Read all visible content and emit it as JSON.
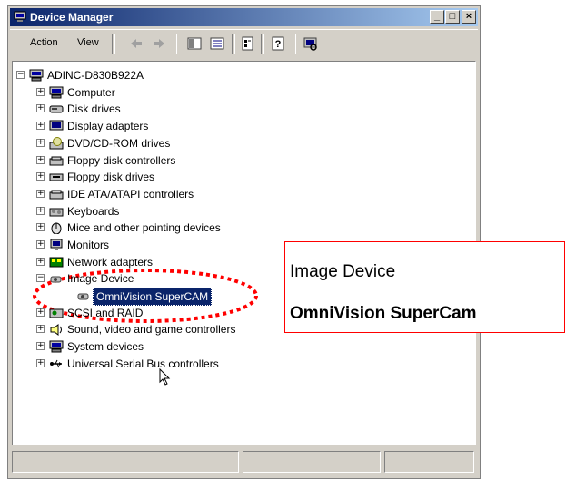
{
  "window": {
    "title": "Device Manager",
    "controls": [
      "minimize",
      "maximize",
      "close"
    ]
  },
  "menu": {
    "items": [
      "Action",
      "View"
    ]
  },
  "toolbar": {
    "icons": [
      "back-arrow-icon",
      "forward-arrow-icon",
      "show-hide-tree-icon",
      "properties-icon",
      "export-list-icon",
      "help-icon",
      "scan-hardware-icon"
    ]
  },
  "tree": {
    "root": "ADINC-D830B922A",
    "items": [
      {
        "label": "Computer",
        "icon": "computer-icon",
        "expanded": false
      },
      {
        "label": "Disk drives",
        "icon": "disk-drive-icon",
        "expanded": false
      },
      {
        "label": "Display adapters",
        "icon": "display-icon",
        "expanded": false
      },
      {
        "label": "DVD/CD-ROM drives",
        "icon": "cdrom-icon",
        "expanded": false
      },
      {
        "label": "Floppy disk controllers",
        "icon": "controller-icon",
        "expanded": false
      },
      {
        "label": "Floppy disk drives",
        "icon": "floppy-drive-icon",
        "expanded": false
      },
      {
        "label": "IDE ATA/ATAPI controllers",
        "icon": "controller-icon",
        "expanded": false
      },
      {
        "label": "Keyboards",
        "icon": "keyboard-icon",
        "expanded": false
      },
      {
        "label": "Mice and other pointing devices",
        "icon": "mouse-icon",
        "expanded": false
      },
      {
        "label": "Monitors",
        "icon": "monitor-icon",
        "expanded": false
      },
      {
        "label": "Network adapters",
        "icon": "network-icon",
        "expanded": false
      },
      {
        "label": "Image Device",
        "icon": "camera-icon",
        "expanded": true
      },
      {
        "label": "SCSI and RAID",
        "icon": "scsi-icon",
        "expanded": false
      },
      {
        "label": "Sound, video and game controllers",
        "icon": "sound-icon",
        "expanded": false
      },
      {
        "label": "System devices",
        "icon": "computer-icon",
        "expanded": false
      },
      {
        "label": "Universal Serial Bus controllers",
        "icon": "usb-icon",
        "expanded": false
      }
    ],
    "child": {
      "label": "OmniVision SuperCAM",
      "icon": "camera-icon",
      "selected": true
    }
  },
  "callout": {
    "line1": "Image Device",
    "line2": "OmniVision SuperCam",
    "border_color": "#ff0000"
  },
  "colors": {
    "titlebar_start": "#0a246a",
    "titlebar_end": "#a6caf0",
    "selection": "#0a246a",
    "highlight_ellipse": "#ff0000"
  }
}
